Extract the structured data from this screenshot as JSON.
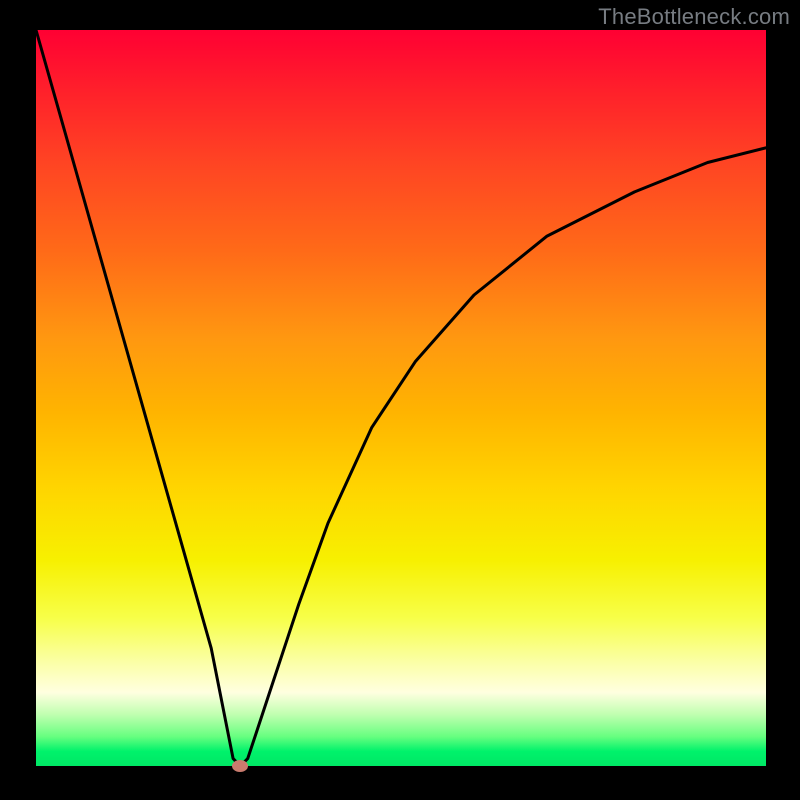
{
  "attribution": "TheBottleneck.com",
  "chart_data": {
    "type": "line",
    "title": "",
    "xlabel": "",
    "ylabel": "",
    "xlim": [
      0,
      100
    ],
    "ylim": [
      0,
      100
    ],
    "series": [
      {
        "name": "bottleneck-curve",
        "x": [
          0,
          4,
          8,
          12,
          16,
          20,
          24,
          26,
          27,
          28,
          29,
          30,
          32,
          36,
          40,
          46,
          52,
          60,
          70,
          82,
          92,
          100
        ],
        "values": [
          100,
          86,
          72,
          58,
          44,
          30,
          16,
          6,
          1,
          0,
          1,
          4,
          10,
          22,
          33,
          46,
          55,
          64,
          72,
          78,
          82,
          84
        ]
      }
    ],
    "markers": [
      {
        "name": "min-marker",
        "x": 28,
        "y": 0,
        "color": "#c97b6e"
      }
    ],
    "gradient_stops": [
      {
        "pos": 0,
        "color": "#ff0033"
      },
      {
        "pos": 50,
        "color": "#ffb400"
      },
      {
        "pos": 75,
        "color": "#f7f000"
      },
      {
        "pos": 100,
        "color": "#00e765"
      }
    ]
  },
  "colors": {
    "curve": "#000000",
    "marker_fill": "#c97b6e",
    "background": "#000000",
    "attribution_text": "#777c82"
  }
}
